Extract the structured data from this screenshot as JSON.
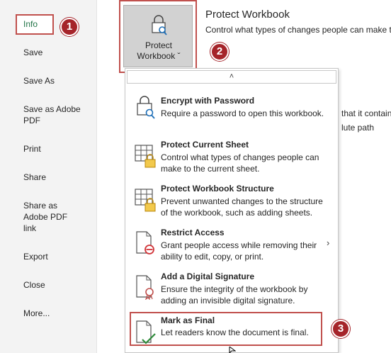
{
  "nav": {
    "items": [
      {
        "label": "Info",
        "active": true
      },
      {
        "label": "Save"
      },
      {
        "label": "Save As"
      },
      {
        "label": "Save as Adobe PDF"
      },
      {
        "label": "Print"
      },
      {
        "label": "Share"
      },
      {
        "label": "Share as Adobe PDF link"
      },
      {
        "label": "Export"
      },
      {
        "label": "Close"
      },
      {
        "label": "More..."
      }
    ]
  },
  "callouts": [
    "1",
    "2",
    "3"
  ],
  "protect": {
    "button_line1": "Protect",
    "button_line2": "Workbook ˇ",
    "title": "Protect Workbook",
    "description": "Control what types of changes people can make t"
  },
  "background_text": {
    "line1": "that it contain",
    "line2": "lute path"
  },
  "menu": {
    "scroll_up": "˄",
    "items": [
      {
        "title": "Encrypt with Password",
        "desc": "Require a password to open this workbook.",
        "icon": "lock-key-icon"
      },
      {
        "title": "Protect Current Sheet",
        "desc": "Control what types of changes people can make to the current sheet.",
        "icon": "sheet-lock-icon"
      },
      {
        "title": "Protect Workbook Structure",
        "desc": "Prevent unwanted changes to the structure of the workbook, such as adding sheets.",
        "icon": "workbook-lock-icon"
      },
      {
        "title": "Restrict Access",
        "desc": "Grant people access while removing their ability to edit, copy, or print.",
        "icon": "restrict-icon",
        "submenu": "›"
      },
      {
        "title": "Add a Digital Signature",
        "desc": "Ensure the integrity of the workbook by adding an invisible digital signature.",
        "icon": "signature-icon"
      },
      {
        "title": "Mark as Final",
        "desc": "Let readers know the document is final.",
        "icon": "final-check-icon"
      }
    ]
  },
  "colors": {
    "accent_green": "#217346",
    "callout_red": "#a5242a",
    "highlight_red": "#c0504d"
  }
}
